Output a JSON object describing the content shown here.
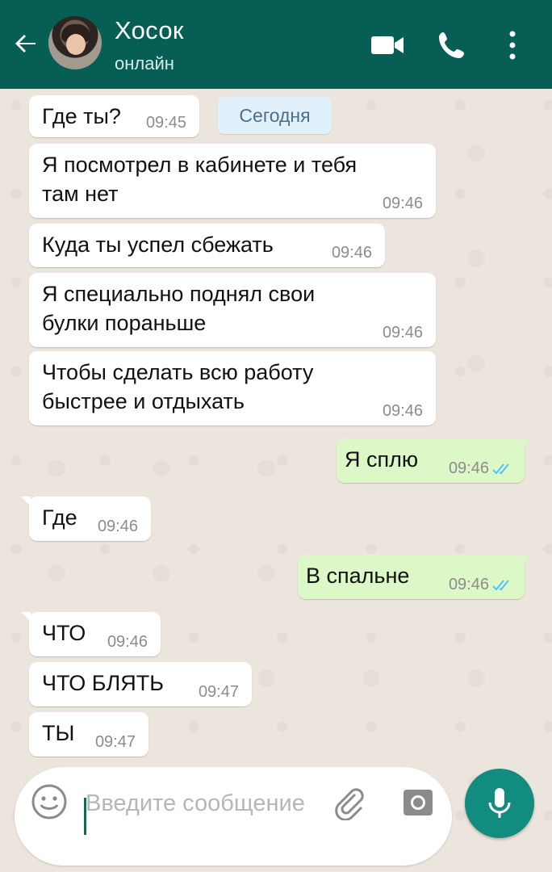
{
  "header": {
    "contact_name": "Хосок",
    "status": "онлайн",
    "icons": [
      "back-arrow-icon",
      "video-call-icon",
      "phone-icon",
      "more-vert-icon"
    ]
  },
  "date_chip": "Сегодня",
  "messages": [
    {
      "direction": "in",
      "text": "Где ты?",
      "time": "09:45"
    },
    {
      "direction": "in",
      "text": "Я посмотрел в кабинете и тебя там нет",
      "time": "09:46"
    },
    {
      "direction": "in",
      "text": "Куда ты успел сбежать",
      "time": "09:46"
    },
    {
      "direction": "in",
      "text": "Я специально поднял свои булки пораньше",
      "time": "09:46"
    },
    {
      "direction": "in",
      "text": "Чтобы сделать всю работу быстрее и отдыхать",
      "time": "09:46"
    },
    {
      "direction": "out",
      "text": "Я сплю",
      "time": "09:46",
      "status": "read"
    },
    {
      "direction": "in",
      "text": "Где",
      "time": "09:46"
    },
    {
      "direction": "out",
      "text": "В спальне",
      "time": "09:46",
      "status": "read"
    },
    {
      "direction": "in",
      "text": "ЧТО",
      "time": "09:46"
    },
    {
      "direction": "in",
      "text": "ЧТО БЛЯТЬ",
      "time": "09:47"
    },
    {
      "direction": "in",
      "text": "ТЫ",
      "time": "09:47"
    }
  ],
  "composer": {
    "placeholder": "Введите сообщение"
  },
  "colors": {
    "header": "#075e54",
    "outgoing_bubble": "#dcf8c6",
    "incoming_bubble": "#ffffff",
    "read_ticks": "#4fc3f7",
    "mic_button": "#128c7e",
    "wallpaper": "#ece5dd"
  }
}
